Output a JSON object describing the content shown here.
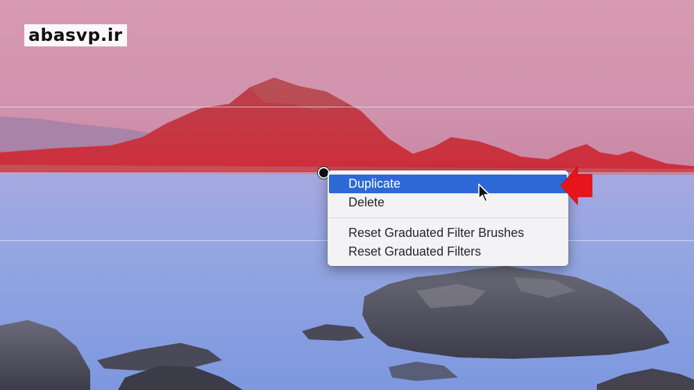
{
  "watermark": {
    "text": "abasvp.ir"
  },
  "context_menu": {
    "items": [
      {
        "label": "Duplicate",
        "highlighted": true
      },
      {
        "label": "Delete",
        "highlighted": false
      },
      {
        "separator": true
      },
      {
        "label": "Reset Graduated Filter Brushes",
        "highlighted": false
      },
      {
        "label": "Reset Graduated Filters",
        "highlighted": false
      }
    ]
  },
  "colors": {
    "sky_top": "#d99bb2",
    "sky_bottom": "#c98aa6",
    "water": "#8a9ee0",
    "mountain": "#c8323f",
    "menu_highlight": "#2d69d6",
    "annotation_arrow": "#e8141b"
  }
}
